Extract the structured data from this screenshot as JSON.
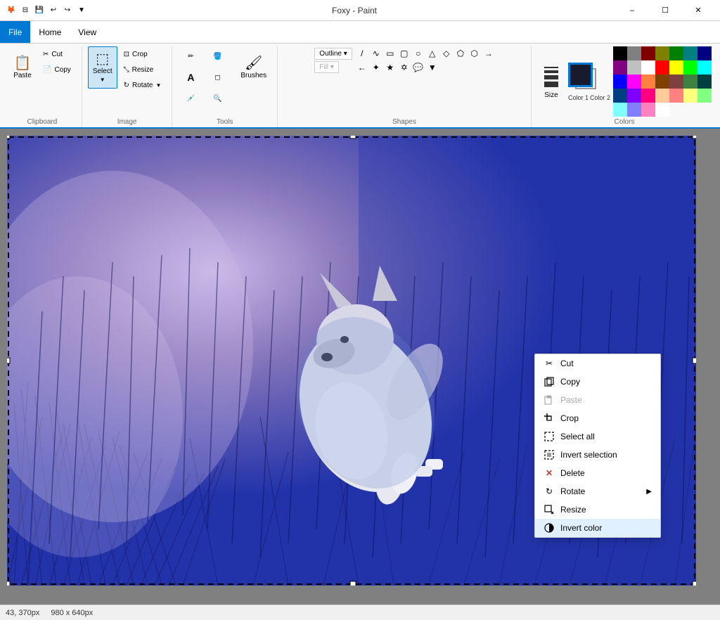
{
  "titleBar": {
    "title": "Foxy - Paint",
    "icons": [
      "⊟",
      "💾",
      "↩",
      "↪",
      "▼"
    ],
    "windowControls": [
      "—",
      "□",
      "✕"
    ]
  },
  "menuBar": {
    "items": [
      "File",
      "Home",
      "View"
    ]
  },
  "ribbon": {
    "clipboard": {
      "label": "Clipboard",
      "paste_label": "Paste",
      "cut_label": "Cut",
      "copy_label": "Copy"
    },
    "image": {
      "label": "Image",
      "crop_label": "Crop",
      "resize_label": "Resize",
      "rotate_label": "Rotate",
      "select_label": "Select"
    },
    "tools": {
      "label": "Tools",
      "brushes_label": "Brushes"
    },
    "shapes": {
      "label": "Shapes"
    },
    "colors": {
      "label": "Colors",
      "size_label": "Size",
      "color1_label": "Color 1",
      "color2_label": "Color 2",
      "outline_label": "Outline ▾",
      "fill_label": "Fill ▾"
    }
  },
  "contextMenu": {
    "items": [
      {
        "id": "cut",
        "label": "Cut",
        "icon": "✂",
        "disabled": false,
        "hasArrow": false
      },
      {
        "id": "copy",
        "label": "Copy",
        "icon": "📋",
        "disabled": false,
        "hasArrow": false
      },
      {
        "id": "paste",
        "label": "Paste",
        "icon": "📄",
        "disabled": true,
        "hasArrow": false
      },
      {
        "id": "crop",
        "label": "Crop",
        "icon": "⊡",
        "disabled": false,
        "hasArrow": false
      },
      {
        "id": "select-all",
        "label": "Select all",
        "icon": "⬚",
        "disabled": false,
        "hasArrow": false
      },
      {
        "id": "invert-selection",
        "label": "Invert selection",
        "icon": "⬜",
        "disabled": false,
        "hasArrow": false
      },
      {
        "id": "delete",
        "label": "Delete",
        "icon": "✕",
        "disabled": false,
        "hasArrow": false
      },
      {
        "id": "rotate",
        "label": "Rotate",
        "icon": "↻",
        "disabled": false,
        "hasArrow": true
      },
      {
        "id": "resize",
        "label": "Resize",
        "icon": "⤡",
        "disabled": false,
        "hasArrow": false
      },
      {
        "id": "invert-color",
        "label": "Invert color",
        "icon": "◑",
        "disabled": false,
        "hasArrow": false
      }
    ]
  },
  "colors": {
    "color1": "#1a1a2e",
    "color2": "#ffffff",
    "palette": [
      "#000000",
      "#808080",
      "#800000",
      "#808000",
      "#008000",
      "#008080",
      "#000080",
      "#800080",
      "#c0c0c0",
      "#ffffff",
      "#ff0000",
      "#ffff00",
      "#00ff00",
      "#00ffff",
      "#0000ff",
      "#ff00ff",
      "#ff8040",
      "#804000",
      "#804040",
      "#408040",
      "#004040",
      "#004080",
      "#8000ff",
      "#ff0080",
      "#ffcc99",
      "#ff8080",
      "#ffff80",
      "#80ff80",
      "#80ffff",
      "#8080ff",
      "#ff80c0",
      "#ffffff"
    ]
  },
  "statusBar": {
    "coords": "43, 370px",
    "size": "980 x 640px"
  }
}
